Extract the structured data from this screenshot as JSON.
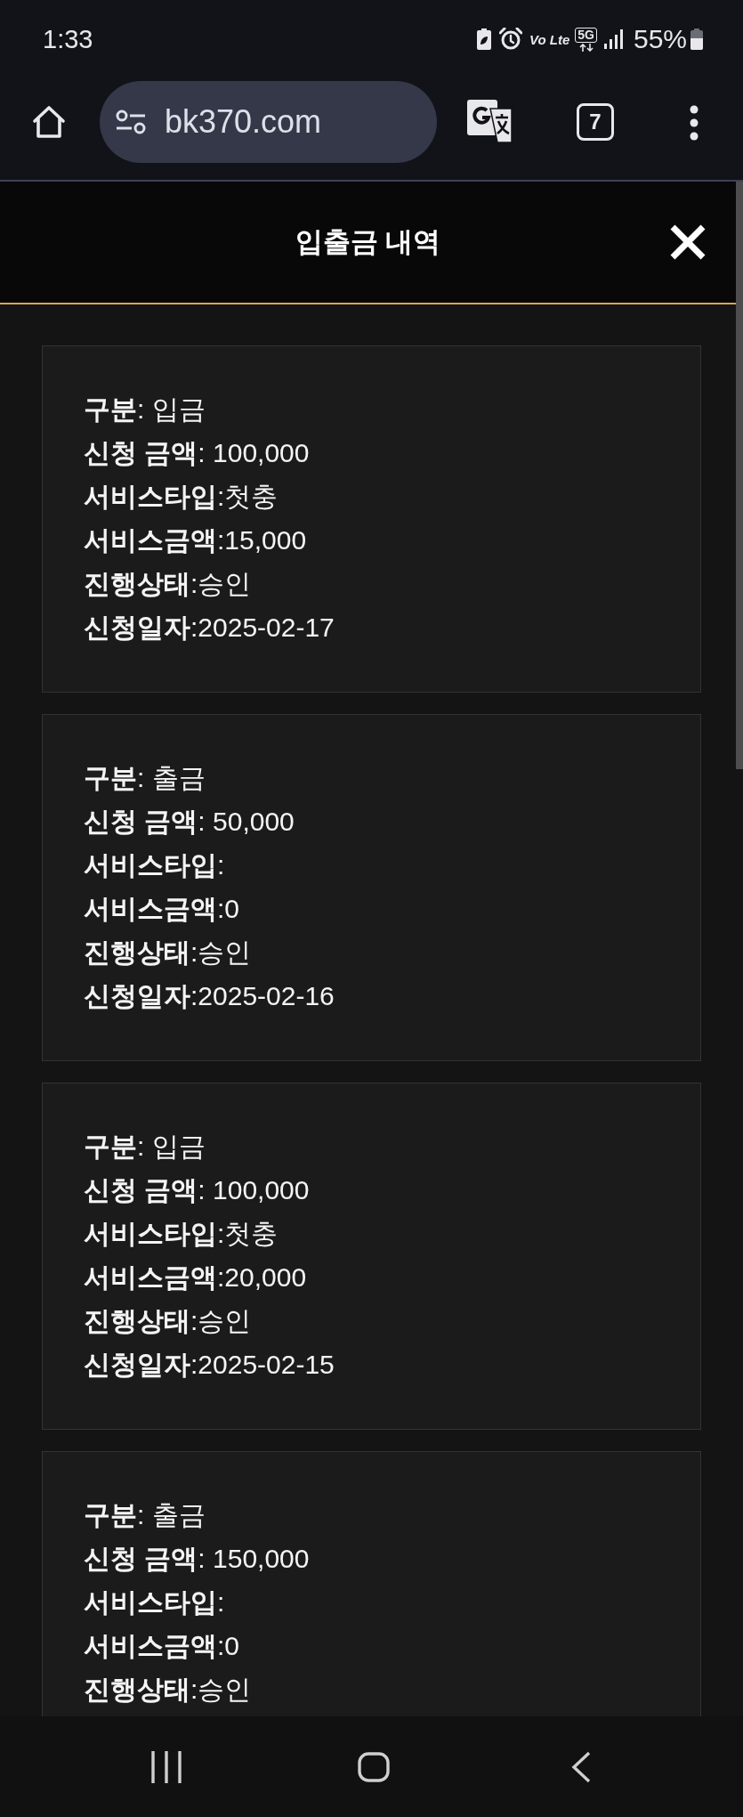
{
  "status_bar": {
    "time": "1:33",
    "volte_label": "Vo Lte",
    "network_type": "5G",
    "battery_percent": "55%"
  },
  "browser_toolbar": {
    "url": "bk370.com",
    "tab_count": "7"
  },
  "dialog": {
    "title": "입출금 내역"
  },
  "records": [
    {
      "lines": [
        "**구분**: 입금",
        "**신청 금액**: 100,000",
        "**서비스타입**:첫충",
        "**서비스금액**:15,000",
        "**진행상태**:승인",
        "**신청일자**:2025-02-17"
      ]
    },
    {
      "lines": [
        "**구분**: 출금",
        "**신청 금액**: 50,000",
        "**서비스타입**:",
        "**서비스금액**:0",
        "**진행상태**:승인",
        "**신청일자**:2025-02-16"
      ]
    },
    {
      "lines": [
        "**구분**: 입금",
        "**신청 금액**: 100,000",
        "**서비스타입**:첫충",
        "**서비스금액**:20,000",
        "**진행상태**:승인",
        "**신청일자**:2025-02-15"
      ]
    },
    {
      "lines": [
        "**구분**: 출금",
        "**신청 금액**: 150,000",
        "**서비스타입**:",
        "**서비스금액**:0",
        "**진행상태**:승인"
      ]
    }
  ]
}
